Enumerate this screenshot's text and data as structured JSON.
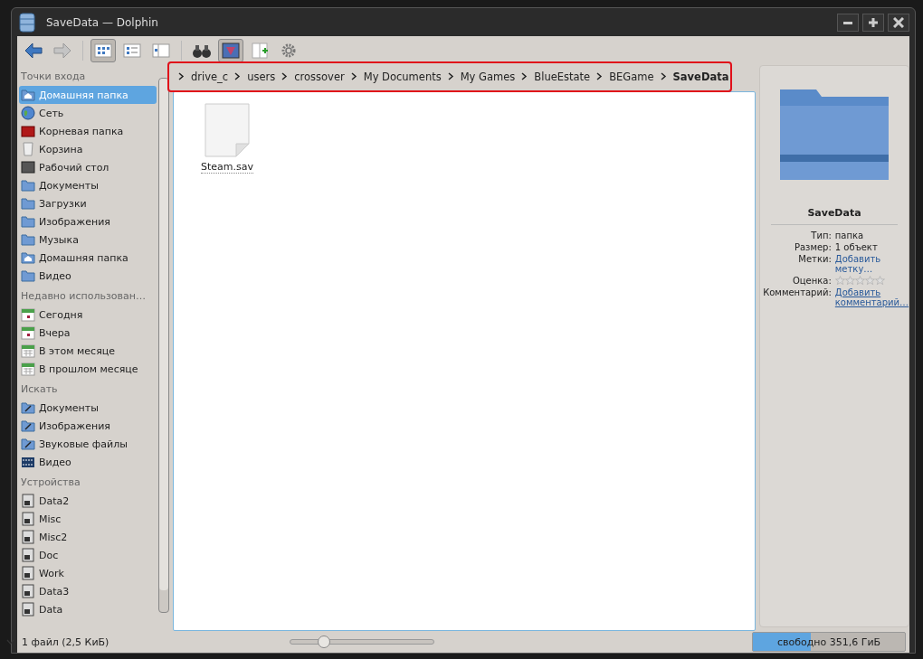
{
  "window": {
    "title": "SaveData — Dolphin"
  },
  "views": [
    {
      "kind": "icons",
      "selected": true
    },
    {
      "kind": "details",
      "selected": false
    },
    {
      "kind": "columns",
      "selected": false
    }
  ],
  "tools": [
    {
      "kind": "find",
      "selected": false
    },
    {
      "kind": "preview",
      "selected": true
    },
    {
      "kind": "split",
      "selected": false
    }
  ],
  "sidebar": [
    {
      "heading": "Точки входа",
      "items": [
        {
          "label": "Домашняя папка",
          "kind": "home",
          "selected": true
        },
        {
          "label": "Сеть",
          "kind": "globe",
          "selected": false
        },
        {
          "label": "Корневая папка",
          "kind": "root",
          "selected": false
        },
        {
          "label": "Корзина",
          "kind": "trash",
          "selected": false
        },
        {
          "label": "Рабочий стол",
          "kind": "desktop",
          "selected": false
        },
        {
          "label": "Документы",
          "kind": "folder",
          "selected": false
        },
        {
          "label": "Загрузки",
          "kind": "folder",
          "selected": false
        },
        {
          "label": "Изображения",
          "kind": "folder",
          "selected": false
        },
        {
          "label": "Музыка",
          "kind": "folder",
          "selected": false
        },
        {
          "label": "Домашняя папка",
          "kind": "home",
          "selected": false
        },
        {
          "label": "Видео",
          "kind": "folder",
          "selected": false
        }
      ]
    },
    {
      "heading": "Недавно использован…",
      "items": [
        {
          "label": "Сегодня",
          "kind": "day",
          "selected": false
        },
        {
          "label": "Вчера",
          "kind": "day",
          "selected": false
        },
        {
          "label": "В этом месяце",
          "kind": "month",
          "selected": false
        },
        {
          "label": "В прошлом месяце",
          "kind": "month",
          "selected": false
        }
      ]
    },
    {
      "heading": "Искать",
      "items": [
        {
          "label": "Документы",
          "kind": "search",
          "selected": false
        },
        {
          "label": "Изображения",
          "kind": "search",
          "selected": false
        },
        {
          "label": "Звуковые файлы",
          "kind": "search",
          "selected": false
        },
        {
          "label": "Видео",
          "kind": "film",
          "selected": false
        }
      ]
    },
    {
      "heading": "Устройства",
      "items": [
        {
          "label": "Data2",
          "kind": "drive",
          "selected": false
        },
        {
          "label": "Misc",
          "kind": "drive",
          "selected": false
        },
        {
          "label": "Misc2",
          "kind": "drive",
          "selected": false
        },
        {
          "label": "Doc",
          "kind": "drive",
          "selected": false
        },
        {
          "label": "Work",
          "kind": "drive",
          "selected": false
        },
        {
          "label": "Data3",
          "kind": "drive",
          "selected": false
        },
        {
          "label": "Data",
          "kind": "drive",
          "selected": false
        }
      ]
    }
  ],
  "breadcrumb": [
    {
      "label": "drive_c",
      "current": false
    },
    {
      "label": "users",
      "current": false
    },
    {
      "label": "crossover",
      "current": false
    },
    {
      "label": "My Documents",
      "current": false
    },
    {
      "label": "My Games",
      "current": false
    },
    {
      "label": "BlueEstate",
      "current": false
    },
    {
      "label": "BEGame",
      "current": false
    },
    {
      "label": "SaveData",
      "current": true
    }
  ],
  "files": [
    {
      "name": "Steam.sav"
    }
  ],
  "info": {
    "title": "SaveData",
    "rows": [
      {
        "kind": "text",
        "label": "Тип:",
        "value": "папка"
      },
      {
        "kind": "text",
        "label": "Размер:",
        "value": "1 объект"
      },
      {
        "kind": "link",
        "label": "Метки:",
        "value": "Добавить метку…"
      },
      {
        "kind": "rating",
        "label": "Оценка:",
        "stars": 0
      },
      {
        "kind": "link",
        "label": "Комментарий:",
        "value": "Добавить комментарий…"
      }
    ]
  },
  "status": {
    "text": "1 файл (2,5 КиБ)",
    "zoom": {
      "level": 0.24
    },
    "space": {
      "text": "свободно 351,6 ГиБ",
      "level": 0.38
    }
  }
}
